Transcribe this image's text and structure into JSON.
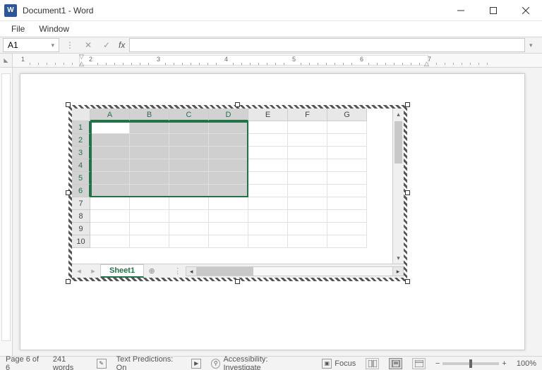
{
  "titlebar": {
    "app_glyph": "W",
    "title": "Document1 - Word"
  },
  "menu": {
    "file": "File",
    "window": "Window"
  },
  "formula": {
    "name_box": "A1",
    "fx_label": "fx",
    "value": ""
  },
  "ruler": {
    "numbers": [
      "1",
      "2",
      "3",
      "4",
      "5",
      "6",
      "7"
    ]
  },
  "sheet": {
    "columns": [
      "A",
      "B",
      "C",
      "D",
      "E",
      "F",
      "G"
    ],
    "rows": [
      "1",
      "2",
      "3",
      "4",
      "5",
      "6",
      "7",
      "8",
      "9",
      "10"
    ],
    "tab": "Sheet1",
    "tab_add": "⊕",
    "selection": {
      "cols": 4,
      "rows": 6
    }
  },
  "status": {
    "page": "Page 6 of 6",
    "words": "241 words",
    "predictions": "Text Predictions: On",
    "accessibility": "Accessibility: Investigate",
    "focus": "Focus",
    "zoom": "100%",
    "zoom_minus": "−",
    "zoom_plus": "+"
  }
}
